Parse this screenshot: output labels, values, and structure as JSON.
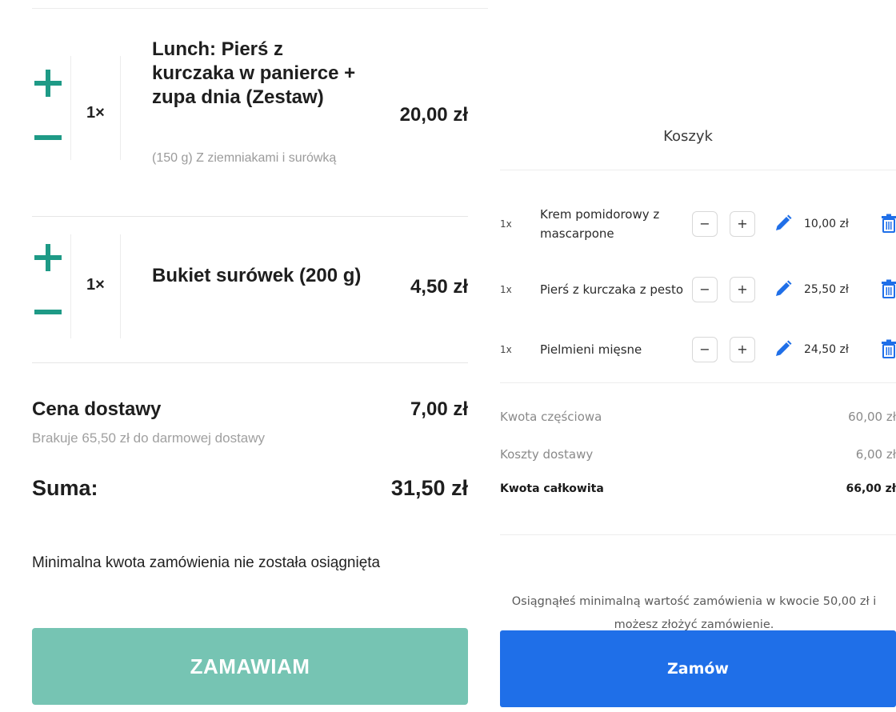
{
  "left_cart": {
    "items": [
      {
        "qty": "1×",
        "name": "Lunch: Pierś z kurczaka w panierce + zupa dnia (Zestaw)",
        "desc": "(150 g) Z ziemniakami i surówką",
        "price": "20,00 zł"
      },
      {
        "qty": "1×",
        "name": "Bukiet surówek (200 g)",
        "desc": "",
        "price": "4,50 zł"
      }
    ],
    "delivery_label": "Cena dostawy",
    "delivery_price": "7,00 zł",
    "delivery_note": "Brakuje 65,50 zł do darmowej dostawy",
    "sum_label": "Suma:",
    "sum_value": "31,50 zł",
    "min_note": "Minimalna kwota zamówienia nie została osiągnięta",
    "order_button": "ZAMAWIAM"
  },
  "right_cart": {
    "title": "Koszyk",
    "items": [
      {
        "qty": "1x",
        "name": "Krem pomidorowy z mascarpone",
        "price": "10,00 zł"
      },
      {
        "qty": "1x",
        "name": "Pierś z kurczaka z pesto",
        "price": "25,50 zł"
      },
      {
        "qty": "1x",
        "name": "Pielmieni mięsne",
        "price": "24,50 zł"
      }
    ],
    "minus_label": "−",
    "plus_label": "+",
    "subtotal_label": "Kwota częściowa",
    "subtotal_value": "60,00 zł",
    "delivery_label": "Koszty dostawy",
    "delivery_value": "6,00 zł",
    "total_label": "Kwota całkowita",
    "total_value": "66,00 zł",
    "min_ok_note": "Osiągnąłeś minimalną wartość zamówienia w kwocie 50,00 zł i możesz złożyć zamówienie.",
    "order_button": "Zamów"
  },
  "icons": {
    "qty_plus": "plus-icon",
    "qty_minus": "minus-icon",
    "edit": "pencil-icon",
    "delete": "trash-icon"
  },
  "colors": {
    "left_accent": "#1e9a86",
    "left_button": "#76c4b3",
    "right_button": "#1f6fe8",
    "icon_blue": "#1f6fe8"
  }
}
